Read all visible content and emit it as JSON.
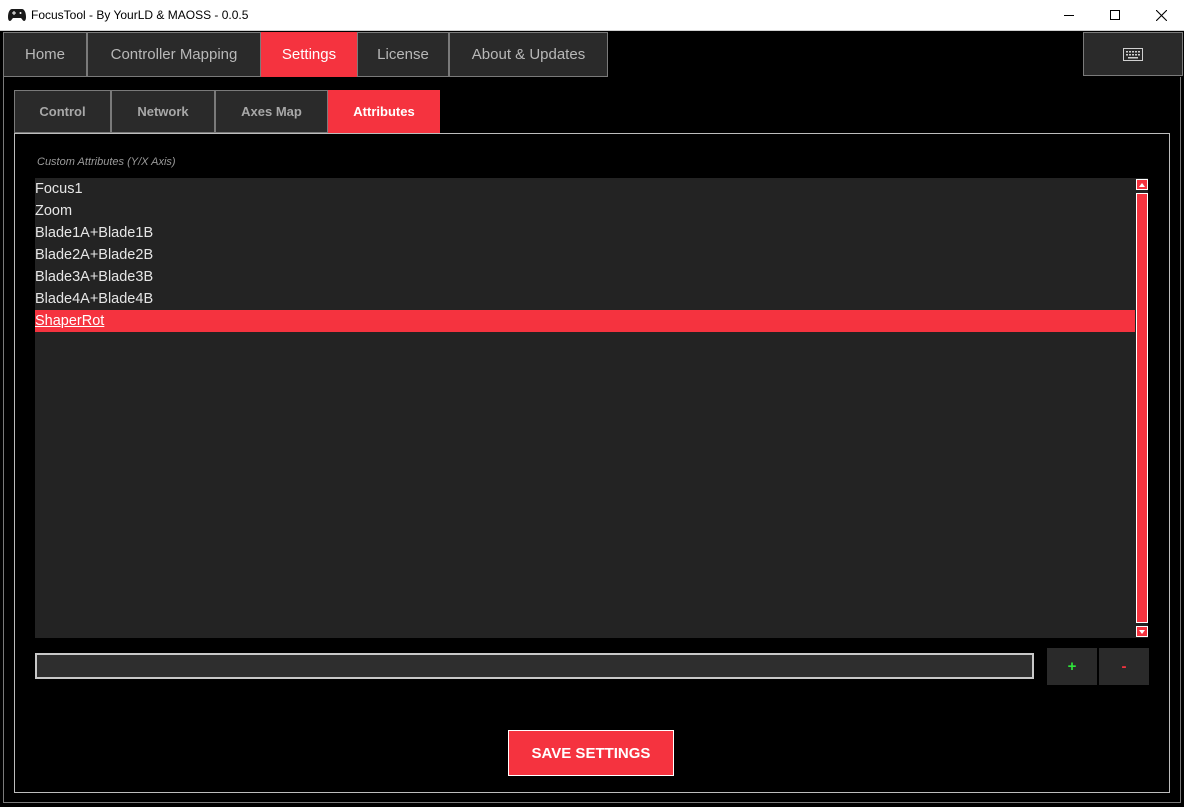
{
  "window": {
    "title": "FocusTool - By YourLD & MAOSS - 0.0.5",
    "app_icon": "gamepad-icon",
    "controls": [
      "minimize-icon",
      "maximize-icon",
      "close-icon"
    ]
  },
  "main_tabs": [
    {
      "label": "Home",
      "active": false
    },
    {
      "label": "Controller Mapping",
      "active": false
    },
    {
      "label": "Settings",
      "active": true
    },
    {
      "label": "License",
      "active": false
    },
    {
      "label": "About & Updates",
      "active": false
    }
  ],
  "keyboard_button_icon": "keyboard-icon",
  "sub_tabs": [
    {
      "label": "Control",
      "active": false
    },
    {
      "label": "Network",
      "active": false
    },
    {
      "label": "Axes Map",
      "active": false
    },
    {
      "label": "Attributes",
      "active": true
    }
  ],
  "attributes": {
    "section_label": "Custom Attributes (Y/X Axis)",
    "items": [
      {
        "label": "Focus1",
        "selected": false
      },
      {
        "label": "Zoom",
        "selected": false
      },
      {
        "label": "Blade1A+Blade1B",
        "selected": false
      },
      {
        "label": "Blade2A+Blade2B",
        "selected": false
      },
      {
        "label": "Blade3A+Blade3B",
        "selected": false
      },
      {
        "label": "Blade4A+Blade4B",
        "selected": false
      },
      {
        "label": "ShaperRot",
        "selected": true
      }
    ],
    "input_value": "",
    "add_label": "+",
    "remove_label": "-"
  },
  "save_label": "SAVE SETTINGS",
  "colors": {
    "accent": "#f5333f",
    "add": "#2ee53a",
    "panel": "#2a2a2a",
    "list_bg": "#232323"
  }
}
